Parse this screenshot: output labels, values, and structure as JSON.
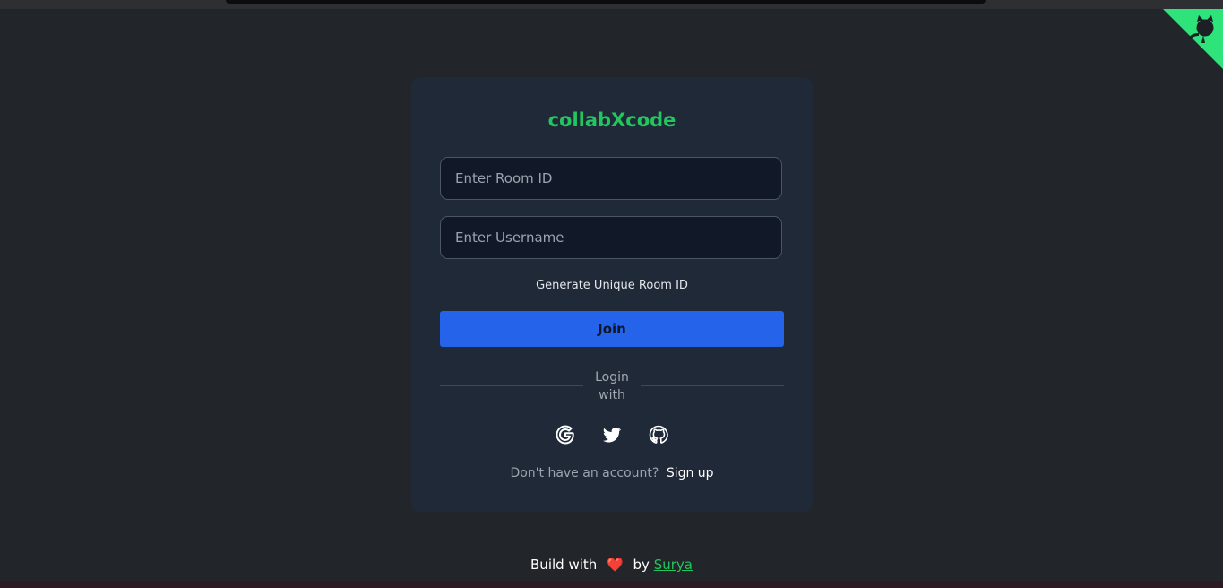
{
  "colors": {
    "background": "#222529",
    "card": "#1f2937",
    "brand": "#22c55e",
    "join_button": "#2563eb",
    "input_background": "#111827",
    "corner_ribbon": "#2ee37a",
    "heart": "#ef4444"
  },
  "corner_ribbon": {
    "icon": "github-octocat-icon"
  },
  "card": {
    "brand": "collabXcode",
    "room_id_placeholder": "Enter Room ID",
    "username_placeholder": "Enter Username",
    "generate_link": "Generate Unique Room ID",
    "join_label": "Join",
    "divider_text": "Login with",
    "social": [
      {
        "name": "google",
        "icon": "google-icon"
      },
      {
        "name": "twitter",
        "icon": "twitter-icon"
      },
      {
        "name": "github",
        "icon": "github-icon"
      }
    ],
    "signup_prompt": "Don't have an account?",
    "signup_link": "Sign up"
  },
  "footer": {
    "prefix": "Build with",
    "heart": "❤️",
    "by": "by",
    "author": "Surya"
  }
}
